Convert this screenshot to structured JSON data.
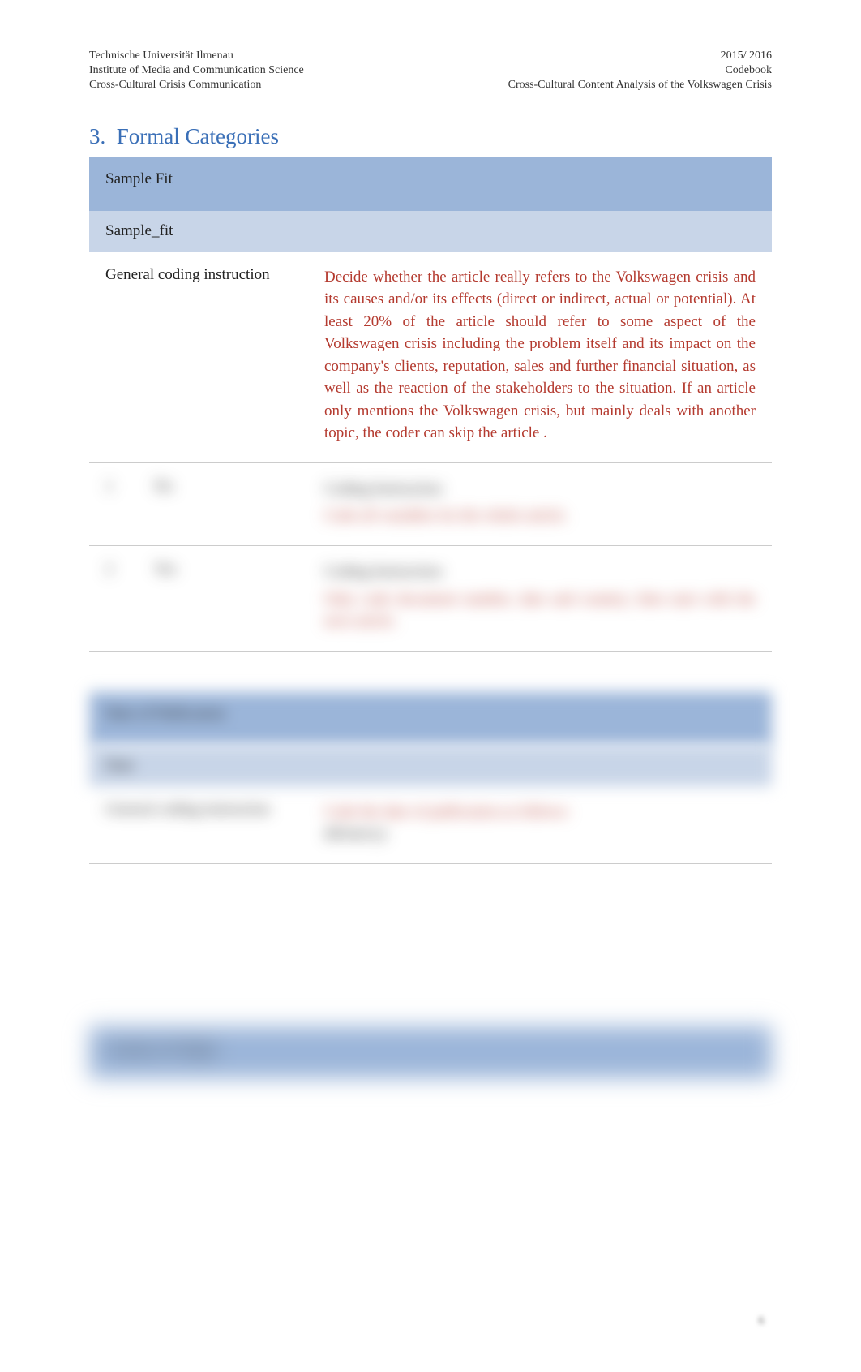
{
  "header": {
    "left": {
      "line1": "Technische Universität Ilmenau",
      "line2": "Institute of Media and Communication Science",
      "line3": "Cross-Cultural Crisis Communication"
    },
    "right": {
      "line1": "2015/ 2016",
      "line2": "Codebook",
      "line3": "Cross-Cultural Content Analysis of the Volkswagen Crisis"
    }
  },
  "section": {
    "number": "3.",
    "title": "Formal Categories"
  },
  "tables": [
    {
      "title": "Sample Fit",
      "variable": "Sample_fit",
      "rows": [
        {
          "label": "General coding instruction",
          "desc": "Decide whether the article really refers to the Volkswagen crisis and its causes and/or its effects (direct or indirect, actual or potential). At least 20% of the article should refer to some aspect of the Volkswagen crisis including the problem itself and its impact on the company's clients, reputation, sales and further financial situation, as well as the reaction of the stakeholders to the situation. If an article only mentions the Volkswagen crisis, but mainly deals with another topic, the coder can skip the article  ."
        },
        {
          "code": "1",
          "name": "No",
          "sublabel": "Coding Instruction:",
          "desc": "Code all variables for the whole article."
        },
        {
          "code": "2",
          "name": "Yes",
          "sublabel": "Coding Instruction:",
          "desc": "Only code document number, date and country; then start with the next article."
        }
      ]
    },
    {
      "title": "Date of Publication",
      "variable": "Date",
      "rows": [
        {
          "label": "General coding instruction",
          "desc": "Code the date of publication as follows:",
          "desc2": "dd/mm/yy"
        }
      ]
    },
    {
      "title": "Country of Origin",
      "variable": ""
    }
  ],
  "page_number": "6"
}
